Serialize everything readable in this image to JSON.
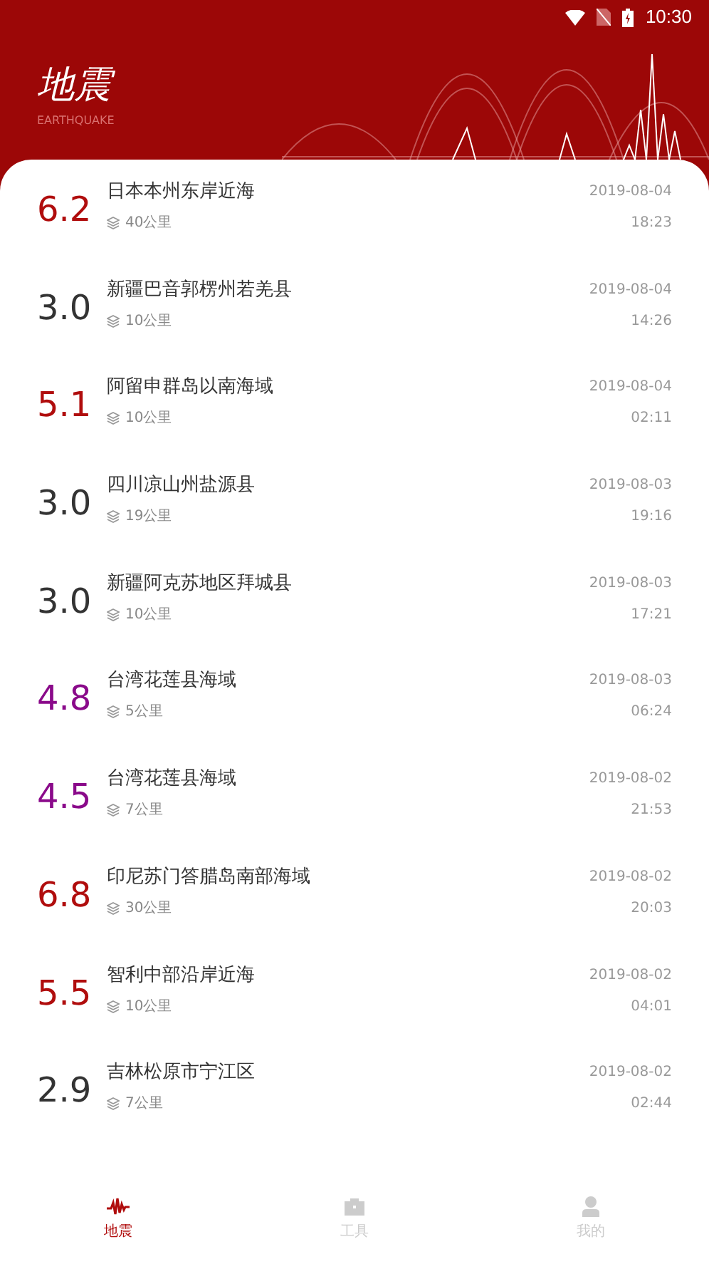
{
  "status_bar": {
    "time": "10:30"
  },
  "header": {
    "title": "地震",
    "subtitle": "EARTHQUAKE"
  },
  "quakes": [
    {
      "magnitude": "6.2",
      "color": "#b00d0d",
      "place": "日本本州东岸近海",
      "depth": "40公里",
      "date": "2019-08-04",
      "time": "18:23"
    },
    {
      "magnitude": "3.0",
      "color": "#333333",
      "place": "新疆巴音郭楞州若羌县",
      "depth": "10公里",
      "date": "2019-08-04",
      "time": "14:26"
    },
    {
      "magnitude": "5.1",
      "color": "#b00d0d",
      "place": "阿留申群岛以南海域",
      "depth": "10公里",
      "date": "2019-08-04",
      "time": "02:11"
    },
    {
      "magnitude": "3.0",
      "color": "#333333",
      "place": "四川凉山州盐源县",
      "depth": "19公里",
      "date": "2019-08-03",
      "time": "19:16"
    },
    {
      "magnitude": "3.0",
      "color": "#333333",
      "place": "新疆阿克苏地区拜城县",
      "depth": "10公里",
      "date": "2019-08-03",
      "time": "17:21"
    },
    {
      "magnitude": "4.8",
      "color": "#8a0a8a",
      "place": "台湾花莲县海域",
      "depth": "5公里",
      "date": "2019-08-03",
      "time": "06:24"
    },
    {
      "magnitude": "4.5",
      "color": "#8a0a8a",
      "place": "台湾花莲县海域",
      "depth": "7公里",
      "date": "2019-08-02",
      "time": "21:53"
    },
    {
      "magnitude": "6.8",
      "color": "#b00d0d",
      "place": "印尼苏门答腊岛南部海域",
      "depth": "30公里",
      "date": "2019-08-02",
      "time": "20:03"
    },
    {
      "magnitude": "5.5",
      "color": "#b00d0d",
      "place": "智利中部沿岸近海",
      "depth": "10公里",
      "date": "2019-08-02",
      "time": "04:01"
    },
    {
      "magnitude": "2.9",
      "color": "#333333",
      "place": "吉林松原市宁江区",
      "depth": "7公里",
      "date": "2019-08-02",
      "time": "02:44"
    }
  ],
  "nav": [
    {
      "kind": "quake",
      "label": "地震",
      "selected": true
    },
    {
      "kind": "tools",
      "label": "工具",
      "selected": false
    },
    {
      "kind": "me",
      "label": "我的",
      "selected": false
    }
  ]
}
